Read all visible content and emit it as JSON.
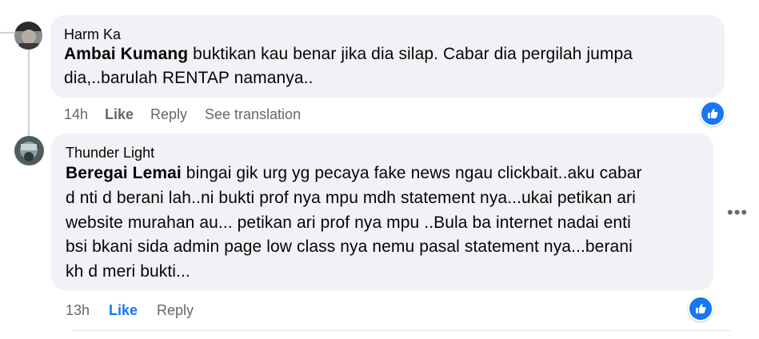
{
  "comments": [
    {
      "author": "Harm Ka",
      "mention": "Ambai Kumang",
      "text_line1": " buktikan kau benar jika dia silap. Cabar dia pergilah jumpa",
      "text_line2": "dia,..barulah RENTAP namanya..",
      "time": "14h",
      "like_label": "Like",
      "reply_label": "Reply",
      "translate_label": "See translation",
      "reaction_icon": "like-reaction-icon"
    },
    {
      "author": "Thunder Light",
      "mention": "Beregai Lemai",
      "text_line1": " bingai gik urg yg pecaya fake news ngau clickbait..aku cabar",
      "text_line2": "d nti d berani lah..ni bukti prof nya mpu mdh statement nya...ukai petikan ari",
      "text_line3": "website murahan au... petikan ari prof nya mpu ..Bula ba internet nadai enti",
      "text_line4": "bsi bkani sida admin page low class nya nemu pasal statement nya...berani",
      "text_line5": "kh d meri bukti...",
      "time": "13h",
      "like_label": "Like",
      "reply_label": "Reply",
      "reaction_icon": "like-reaction-icon"
    }
  ],
  "more_menu": "•••",
  "colors": {
    "bubble": "#f0f2f5",
    "accent": "#1877f2",
    "secondary_text": "#65676b"
  }
}
